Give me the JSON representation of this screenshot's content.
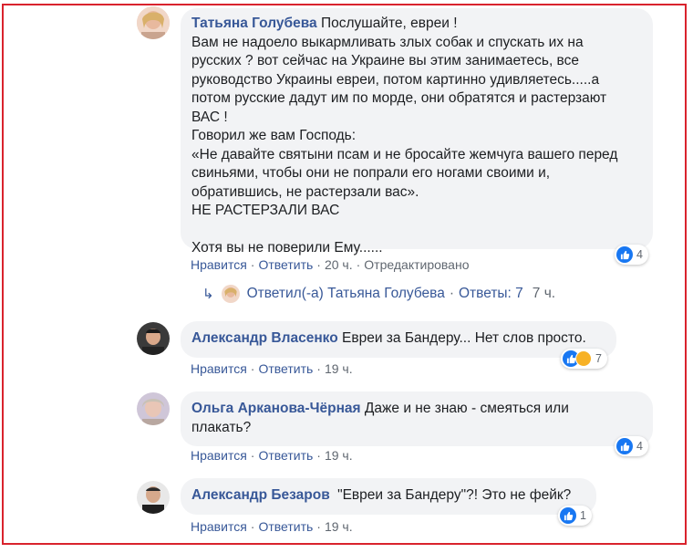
{
  "comments": [
    {
      "author": "Татьяна Голубева",
      "lines": [
        "Послушайте, евреи !",
        "Вам не надоело выкармливать злых собак и спускать их на",
        "русских ? вот сейчас на Украине вы этим занимаетесь, все",
        "руководство Украины евреи, потом картинно удивляетесь.....а",
        "потом русские дадут им по морде, они обратятся и растерзают",
        "ВАС !",
        "Говорил же вам Господь:",
        "«Не давайте святыни псам и не бросайте жемчуга вашего перед",
        "свиньями, чтобы они не попрали его ногами своими и,",
        "обратившись, не растерзали вас».",
        "НЕ РАСТЕРЗАЛИ ВАС",
        "",
        "Хотя вы не поверили Ему......"
      ],
      "like": "Нравится",
      "reply": "Ответить",
      "time": "20 ч.",
      "edited": "Отредактировано",
      "reactions": "4"
    },
    {
      "author": "Александр Власенко",
      "text": "Евреи за Бандеру... Нет слов просто.",
      "like": "Нравится",
      "reply": "Ответить",
      "time": "19 ч.",
      "reactions": "7"
    },
    {
      "author": "Ольга Арканова-Чёрная",
      "text": "Даже и не знаю - смеяться или плакать?",
      "text_line1": "Даже и не знаю - смеяться или",
      "text_line2": "плакать?",
      "like": "Нравится",
      "reply": "Ответить",
      "time": "19 ч.",
      "reactions": "4"
    },
    {
      "author": "Александр Безаров",
      "text": "\"Евреи за Бандеру\"?! Это не фейк?",
      "like": "Нравится",
      "reply": "Ответить",
      "time": "19 ч.",
      "reactions": "1"
    }
  ],
  "reply_thread": {
    "label": "Ответил(-а) Татьяна Голубева",
    "replies": "Ответы: 7",
    "time": "7 ч."
  },
  "colors": {
    "frame": "#d9232d",
    "link": "#385898",
    "bubble": "#f2f3f5",
    "like": "#1877f2"
  }
}
